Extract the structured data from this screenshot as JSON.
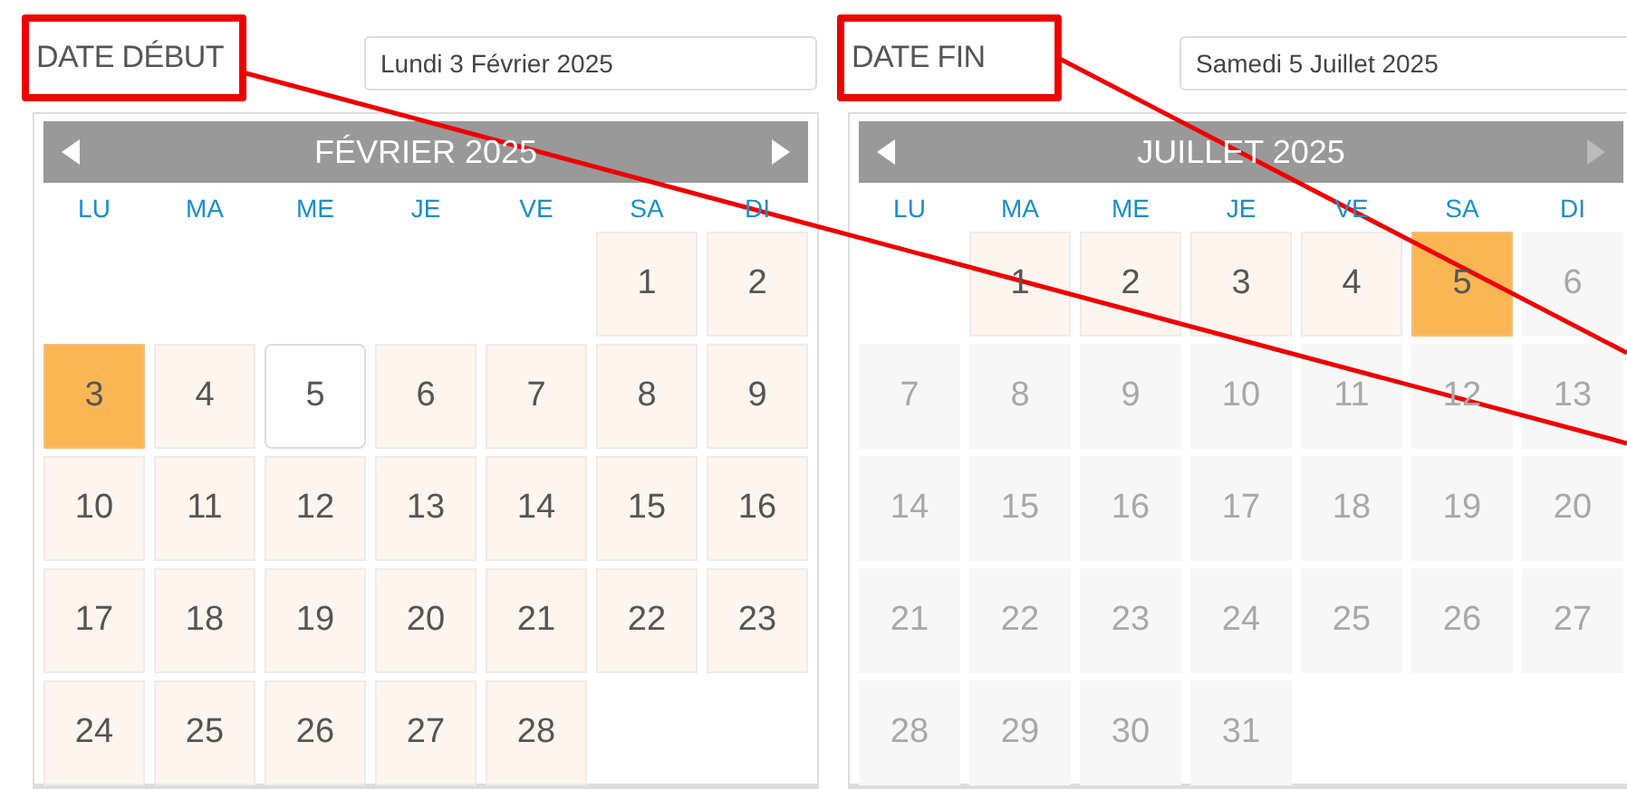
{
  "fields": [
    {
      "label": "DATE DÉBUT",
      "highlighted": true,
      "callout_line": true,
      "value": "Lundi 3 Février 2025",
      "calendar": {
        "title": "FÉVRIER 2025",
        "prev_disabled": false,
        "next_disabled": false,
        "weekdays": [
          "LU",
          "MA",
          "ME",
          "JE",
          "VE",
          "SA",
          "DI"
        ],
        "weeks": [
          [
            {
              "kind": "blank"
            },
            {
              "kind": "blank"
            },
            {
              "kind": "blank"
            },
            {
              "kind": "blank"
            },
            {
              "kind": "blank"
            },
            {
              "day": "1",
              "kind": "open",
              "selected": false
            },
            {
              "day": "2",
              "kind": "open",
              "selected": false
            }
          ],
          [
            {
              "day": "3",
              "kind": "open",
              "selected": true
            },
            {
              "day": "4",
              "kind": "open",
              "selected": false
            },
            {
              "day": "5",
              "kind": "today",
              "selected": false
            },
            {
              "day": "6",
              "kind": "open",
              "selected": false
            },
            {
              "day": "7",
              "kind": "open",
              "selected": false
            },
            {
              "day": "8",
              "kind": "open",
              "selected": false
            },
            {
              "day": "9",
              "kind": "open",
              "selected": false
            }
          ],
          [
            {
              "day": "10",
              "kind": "open",
              "selected": false
            },
            {
              "day": "11",
              "kind": "open",
              "selected": false
            },
            {
              "day": "12",
              "kind": "open",
              "selected": false
            },
            {
              "day": "13",
              "kind": "open",
              "selected": false
            },
            {
              "day": "14",
              "kind": "open",
              "selected": false
            },
            {
              "day": "15",
              "kind": "open",
              "selected": false
            },
            {
              "day": "16",
              "kind": "open",
              "selected": false
            }
          ],
          [
            {
              "day": "17",
              "kind": "open",
              "selected": false
            },
            {
              "day": "18",
              "kind": "open",
              "selected": false
            },
            {
              "day": "19",
              "kind": "open",
              "selected": false
            },
            {
              "day": "20",
              "kind": "open",
              "selected": false
            },
            {
              "day": "21",
              "kind": "open",
              "selected": false
            },
            {
              "day": "22",
              "kind": "open",
              "selected": false
            },
            {
              "day": "23",
              "kind": "open",
              "selected": false
            }
          ],
          [
            {
              "day": "24",
              "kind": "open",
              "selected": false
            },
            {
              "day": "25",
              "kind": "open",
              "selected": false
            },
            {
              "day": "26",
              "kind": "open",
              "selected": false
            },
            {
              "day": "27",
              "kind": "open",
              "selected": false
            },
            {
              "day": "28",
              "kind": "open",
              "selected": false
            },
            {
              "kind": "blank"
            },
            {
              "kind": "blank"
            }
          ]
        ]
      }
    },
    {
      "label": "DATE FIN",
      "highlighted": true,
      "callout_line": true,
      "value": "Samedi 5 Juillet 2025",
      "calendar": {
        "title": "JUILLET 2025",
        "prev_disabled": false,
        "next_disabled": true,
        "weekdays": [
          "LU",
          "MA",
          "ME",
          "JE",
          "VE",
          "SA",
          "DI"
        ],
        "weeks": [
          [
            {
              "kind": "blank"
            },
            {
              "day": "1",
              "kind": "open",
              "selected": false
            },
            {
              "day": "2",
              "kind": "open",
              "selected": false
            },
            {
              "day": "3",
              "kind": "open",
              "selected": false
            },
            {
              "day": "4",
              "kind": "open",
              "selected": false
            },
            {
              "day": "5",
              "kind": "open",
              "selected": true
            },
            {
              "day": "6",
              "kind": "closed",
              "selected": false
            }
          ],
          [
            {
              "day": "7",
              "kind": "closed",
              "selected": false
            },
            {
              "day": "8",
              "kind": "closed",
              "selected": false
            },
            {
              "day": "9",
              "kind": "closed",
              "selected": false
            },
            {
              "day": "10",
              "kind": "closed",
              "selected": false
            },
            {
              "day": "11",
              "kind": "closed",
              "selected": false
            },
            {
              "day": "12",
              "kind": "closed",
              "selected": false
            },
            {
              "day": "13",
              "kind": "closed",
              "selected": false
            }
          ],
          [
            {
              "day": "14",
              "kind": "closed",
              "selected": false
            },
            {
              "day": "15",
              "kind": "closed",
              "selected": false
            },
            {
              "day": "16",
              "kind": "closed",
              "selected": false
            },
            {
              "day": "17",
              "kind": "closed",
              "selected": false
            },
            {
              "day": "18",
              "kind": "closed",
              "selected": false
            },
            {
              "day": "19",
              "kind": "closed",
              "selected": false
            },
            {
              "day": "20",
              "kind": "closed",
              "selected": false
            }
          ],
          [
            {
              "day": "21",
              "kind": "closed",
              "selected": false
            },
            {
              "day": "22",
              "kind": "closed",
              "selected": false
            },
            {
              "day": "23",
              "kind": "closed",
              "selected": false
            },
            {
              "day": "24",
              "kind": "closed",
              "selected": false
            },
            {
              "day": "25",
              "kind": "closed",
              "selected": false
            },
            {
              "day": "26",
              "kind": "closed",
              "selected": false
            },
            {
              "day": "27",
              "kind": "closed",
              "selected": false
            }
          ],
          [
            {
              "day": "28",
              "kind": "closed",
              "selected": false
            },
            {
              "day": "29",
              "kind": "closed",
              "selected": false
            },
            {
              "day": "30",
              "kind": "closed",
              "selected": false
            },
            {
              "day": "31",
              "kind": "closed",
              "selected": false
            },
            {
              "kind": "blank"
            },
            {
              "kind": "blank"
            },
            {
              "kind": "blank"
            }
          ]
        ]
      }
    }
  ]
}
